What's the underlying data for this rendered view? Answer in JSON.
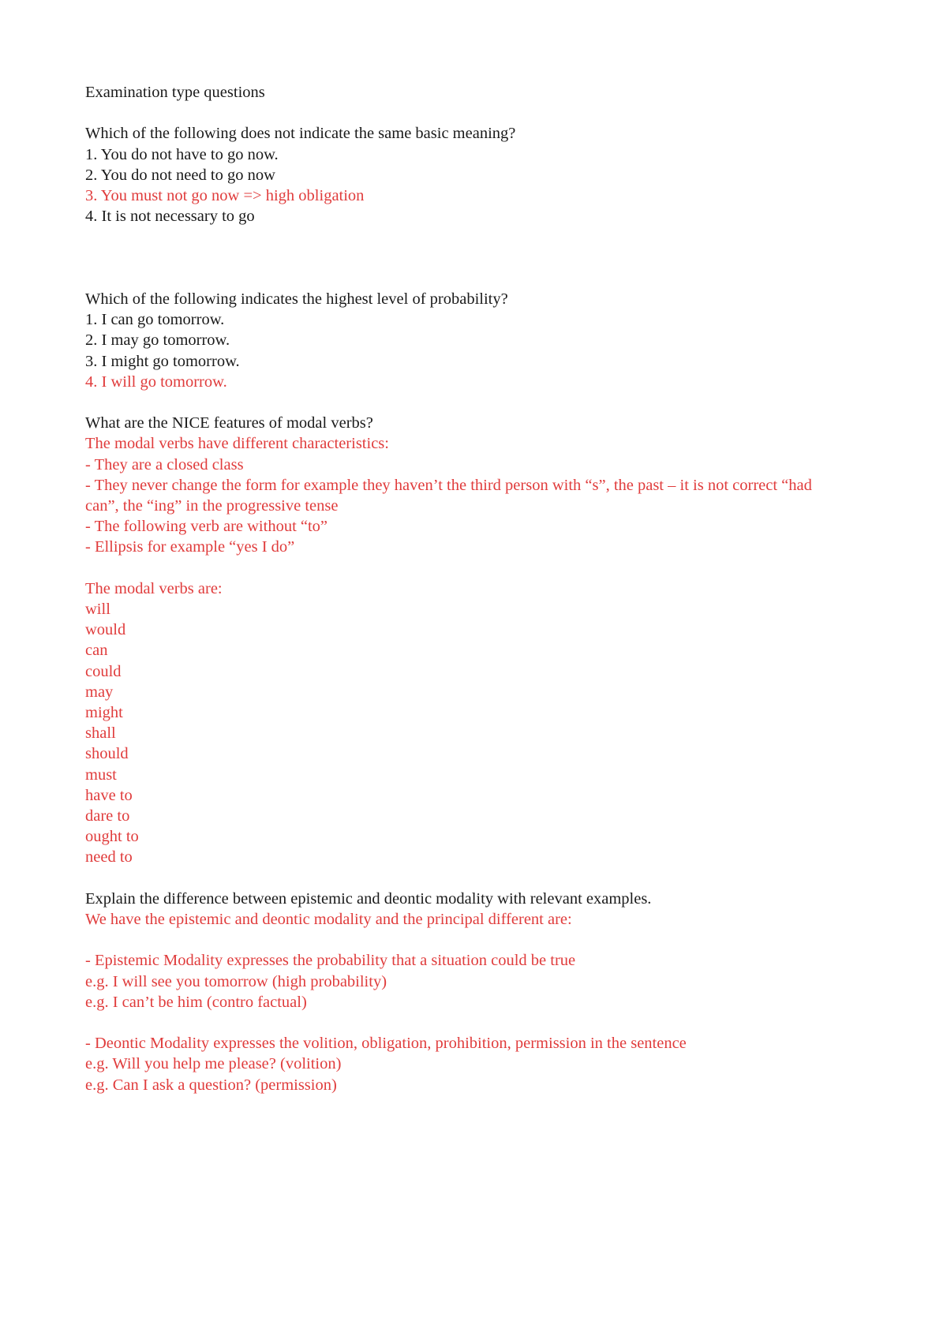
{
  "document": {
    "title_line": "Examination type questions",
    "colors": {
      "answer_red": "#E03C3C",
      "question_black": "#1a1a1a",
      "page_background": "#ffffff"
    },
    "questions": [
      {
        "id": "q1",
        "prompt": "Which of the following does not indicate the same basic meaning?",
        "options": [
          {
            "label": "1. You do not have to go now.",
            "highlighted": false
          },
          {
            "label": "2. You do not need to go now",
            "highlighted": false
          },
          {
            "label": "3. You must not go now => high obligation",
            "highlighted": true
          },
          {
            "label": "4. It is not necessary to go",
            "highlighted": false
          }
        ]
      },
      {
        "id": "q2",
        "prompt": "Which of the following indicates the highest level of probability?",
        "options": [
          {
            "label": "1. I can go tomorrow.",
            "highlighted": false
          },
          {
            "label": "2. I may go tomorrow.",
            "highlighted": false
          },
          {
            "label": "3. I might go tomorrow.",
            "highlighted": false
          },
          {
            "label": "4. I will go tomorrow.",
            "highlighted": true
          }
        ]
      }
    ],
    "nice_section": {
      "prompt": "What are the NICE features of modal verbs?",
      "intro": "The modal verbs have different characteristics:",
      "features": [
        "- They are a closed class",
        "- They never change the form for example they haven’t the third person with “s”, the past – it is not correct “had can”, the “ing” in the progressive tense",
        "- The following verb are without “to”",
        "- Ellipsis for example “yes I do”"
      ]
    },
    "modal_verbs_section": {
      "heading": "The modal verbs are:",
      "verbs": [
        "will",
        "would",
        "can",
        "could",
        "may",
        "might",
        "shall",
        "should",
        "must",
        "have to",
        "dare to",
        "ought to",
        "need to"
      ]
    },
    "modality_section": {
      "prompt": "Explain the difference between epistemic and deontic modality with relevant examples.",
      "intro": "We have the epistemic and deontic modality and the principal different are:",
      "epistemic": {
        "definition": "- Epistemic Modality expresses the probability that a situation could be true",
        "examples": [
          "e.g. I will see you tomorrow (high probability)",
          "e.g. I can’t be him (contro factual)"
        ]
      },
      "deontic": {
        "definition": "- Deontic Modality expresses the volition, obligation, prohibition, permission in the sentence",
        "examples": [
          "e.g. Will you help me please? (volition)",
          "e.g. Can I ask a question? (permission)"
        ]
      }
    }
  }
}
